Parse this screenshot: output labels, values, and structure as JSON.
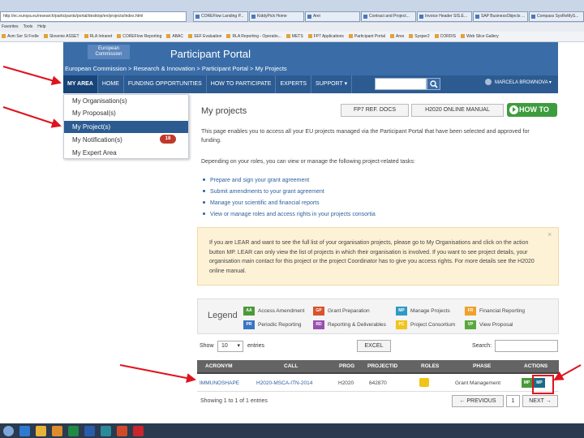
{
  "browser": {
    "url": "http://ec.europa.eu/research/participants/portal/desktop/en/projects/index.html",
    "tabs": [
      "COREFlow Landing P...",
      "KiddyPick Home",
      "Arei",
      "Contract and Project...",
      "Invoice Header SIS.E...",
      "SAP BusinessObjects ...",
      "Compass SysReMyS..."
    ],
    "menu": [
      "Favorites",
      "Tools",
      "Help"
    ],
    "favorites": [
      "Avm Ser Si Frelle",
      "Slovenie ASSET",
      "RLA Intranet",
      "COREFlow Reporting",
      "ABAC",
      "SEF Evaluation",
      "RLA Reporting - Operatio...",
      "METS",
      "FP7 Applications",
      "Participant Portal",
      "Ares",
      "Sysper2",
      "CORDIS",
      "Web Slice Gallery"
    ]
  },
  "header": {
    "logo_line1": "European",
    "logo_line2": "Commission",
    "title": "Participant Portal",
    "breadcrumb": "European Commission > Research & Innovation > Participant Portal > My Projects"
  },
  "nav": {
    "items": [
      "MY AREA",
      "HOME",
      "FUNDING OPPORTUNITIES",
      "HOW TO PARTICIPATE",
      "EXPERTS",
      "SUPPORT ▾"
    ],
    "user": "MARCELA BROWNOVA ▾"
  },
  "dropdown": {
    "items": [
      "My Organisation(s)",
      "My Proposal(s)",
      "My Project(s)",
      "My Notification(s)",
      "My Expert Area"
    ],
    "notification_count": "18"
  },
  "main": {
    "title": "My projects",
    "btn_fp7": "FP7 REF. DOCS",
    "btn_h2020": "H2020 ONLINE MANUAL",
    "btn_howto": "HOW TO",
    "intro": "This page enables you to access all your EU projects managed via the Participant Portal that have been selected and approved for funding.",
    "roles_text": "Depending on your roles, you can view or manage the following project-related tasks:",
    "tasks": [
      "Prepare and sign your grant agreement",
      "Submit amendments to your grant agreement",
      "Manage your scientific and financial reports",
      "View or manage roles and access rights in your projects consortia"
    ],
    "notice": "If you are LEAR and want to see the full list of your organisation projects, please go to My Organisations and click on the action button MP. LEAR can only view the list of projects in which their organisation is involved. If you want to see project details, your organisation main contact for this project or the project Coordinator has to give you access rights. For more details see the H2020 online manual.",
    "notice_close": "×"
  },
  "legend": {
    "title": "Legend",
    "items": [
      {
        "code": "AA",
        "label": "Access Amendment",
        "color": "#4a9a3a"
      },
      {
        "code": "GP",
        "label": "Grant Preparation",
        "color": "#d9532b"
      },
      {
        "code": "MP",
        "label": "Manage Projects",
        "color": "#2e9bc5"
      },
      {
        "code": "FR",
        "label": "Financial Reporting",
        "color": "#f0a12a"
      },
      {
        "code": "PR",
        "label": "Periodic Reporting",
        "color": "#3a74c4"
      },
      {
        "code": "RD",
        "label": "Reporting & Deliverables",
        "color": "#9a4fb0"
      },
      {
        "code": "PC",
        "label": "Project Consortium",
        "color": "#f0c419"
      },
      {
        "code": "VP",
        "label": "View Proposal",
        "color": "#5aa83d"
      }
    ]
  },
  "table": {
    "show_label": "Show",
    "show_value": "10",
    "entries_label": "entries",
    "excel": "EXCEL",
    "search_label": "Search:",
    "headers": [
      "ACRONYM",
      "CALL",
      "PROG",
      "PROJECTID",
      "ROLES",
      "PHASE",
      "ACTIONS"
    ],
    "row": {
      "acronym": "IMMUNOSHAPE",
      "call": "H2020-MSCA-ITN-2014",
      "prog": "H2020",
      "projectid": "642870",
      "phase": "Grant Management",
      "action1": "MP",
      "action2": "MP"
    },
    "showing": "Showing 1 to 1 of 1 entries",
    "prev": "← PREVIOUS",
    "page": "1",
    "next": "NEXT →"
  },
  "colors": {
    "header": "#3a6da8",
    "nav": "#2c5b92",
    "accent_red": "#e0121e",
    "howto_green": "#3d9c3d"
  }
}
